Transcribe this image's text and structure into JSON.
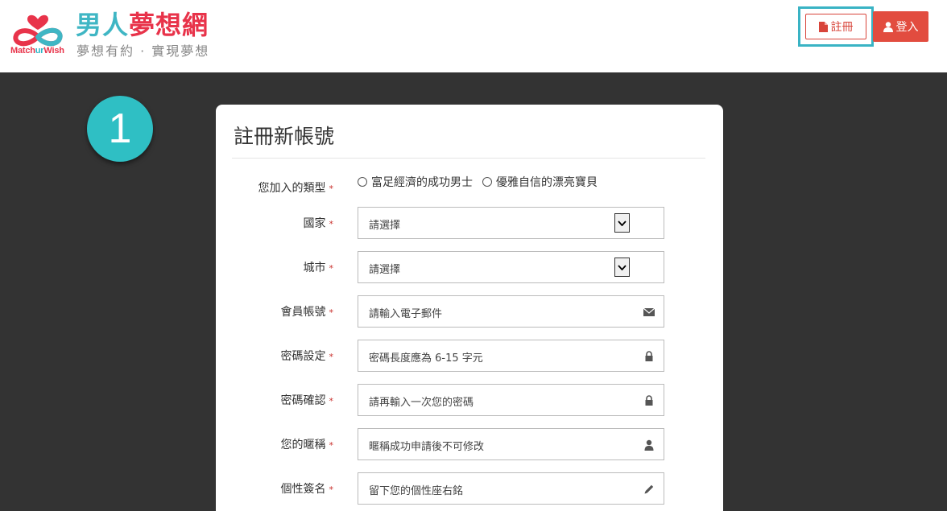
{
  "header": {
    "brand_part1": "男人",
    "brand_part2": "夢想網",
    "logo_text_part1": "Match",
    "logo_text_part2": "ur",
    "logo_text_part3": "Wish",
    "tagline": "夢想有約 · 實現夢想",
    "register_label": "註冊",
    "login_label": "登入"
  },
  "step_number": "1",
  "form": {
    "title": "註冊新帳號",
    "type_label": "您加入的類型",
    "type_options": [
      "富足經濟的成功男士",
      "優雅自信的漂亮寶貝"
    ],
    "country_label": "國家",
    "country_value": "請選擇",
    "city_label": "城市",
    "city_value": "請選擇",
    "account_label": "會員帳號",
    "account_placeholder": "請輸入電子郵件",
    "password_label": "密碼設定",
    "password_placeholder": "密碼長度應為 6-15 字元",
    "confirm_label": "密碼確認",
    "confirm_placeholder": "請再輸入一次您的密碼",
    "nickname_label": "您的暱稱",
    "nickname_placeholder": "暱稱成功申請後不可修改",
    "signature_label": "個性簽名",
    "signature_placeholder": "留下您的個性座右銘",
    "required_mark": "*"
  },
  "colors": {
    "brand_teal": "#3fb6c4",
    "brand_pink": "#e8334a",
    "login_red": "#e24c3f",
    "background": "#333333"
  }
}
